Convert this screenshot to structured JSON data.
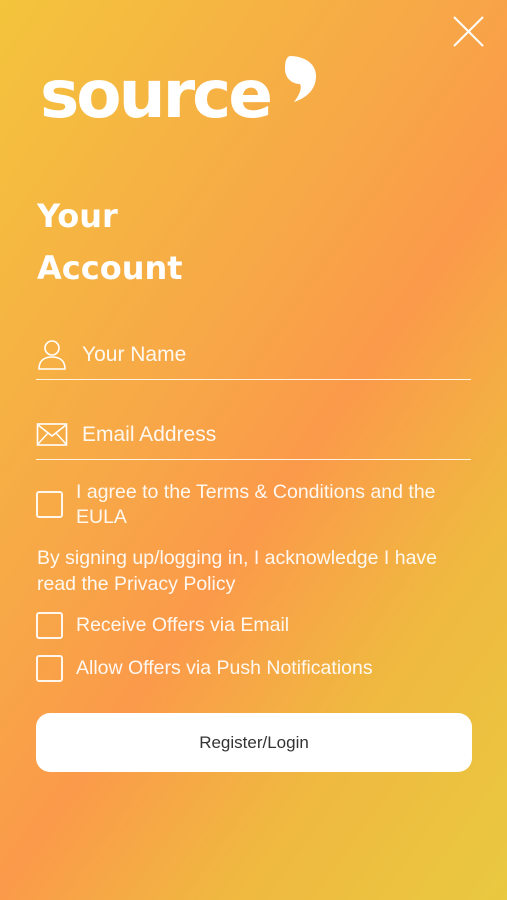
{
  "brand": {
    "logo_text": "source"
  },
  "header": {
    "close_icon": "close-icon"
  },
  "title": {
    "line1": "Your",
    "line2": "Account"
  },
  "form": {
    "name": {
      "placeholder": "Your Name",
      "value": "",
      "icon": "user-icon"
    },
    "email": {
      "placeholder": "Email Address",
      "value": "",
      "icon": "envelope-icon"
    },
    "terms_label": "I agree to the Terms & Conditions and the EULA",
    "acknowledge_text": "By signing up/logging in, I acknowledge I have read the Privacy Policy",
    "offers_email_label": "Receive Offers via Email",
    "offers_push_label": "Allow Offers via Push Notifications",
    "submit_label": "Register/Login"
  },
  "colors": {
    "gradient_start": "#f4c43c",
    "gradient_mid": "#fb9a4a",
    "text": "#ffffff",
    "button_bg": "#ffffff",
    "button_text": "#333333"
  }
}
